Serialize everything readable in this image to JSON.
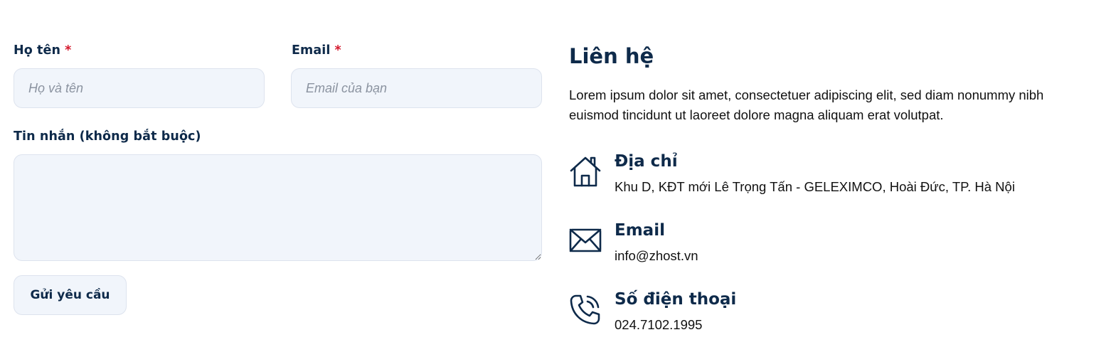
{
  "form": {
    "name": {
      "label": "Họ tên",
      "required_mark": "*",
      "placeholder": "Họ và tên"
    },
    "email": {
      "label": "Email",
      "required_mark": "*",
      "placeholder": "Email của bạn"
    },
    "message": {
      "label": "Tin nhắn (không bắt buộc)",
      "value": ""
    },
    "submit_label": "Gửi yêu cầu"
  },
  "contact": {
    "title": "Liên hệ",
    "description": "Lorem ipsum dolor sit amet, consectetuer adipiscing elit, sed diam nonummy nibh euismod tincidunt ut laoreet dolore magna aliquam erat volutpat.",
    "items": [
      {
        "icon": "house-icon",
        "title": "Địa chỉ",
        "value": "Khu D, KĐT mới Lê Trọng Tấn - GELEXIMCO, Hoài Đức, TP. Hà Nội"
      },
      {
        "icon": "envelope-icon",
        "title": "Email",
        "value": "info@zhost.vn"
      },
      {
        "icon": "phone-icon",
        "title": "Số điện thoại",
        "value": "024.7102.1995"
      }
    ]
  },
  "colors": {
    "primary": "#0e2a4a",
    "required": "#d4182c",
    "input_bg": "#f1f5fb",
    "input_border": "#dde3ee"
  }
}
